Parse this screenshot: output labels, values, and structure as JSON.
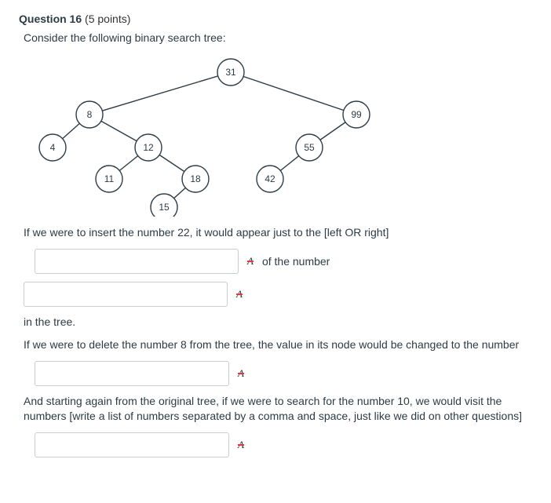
{
  "question": {
    "label": "Question 16",
    "points": "(5 points)",
    "intro": "Consider the following binary search tree:"
  },
  "tree": {
    "root": "31",
    "n8": "8",
    "n99": "99",
    "n4": "4",
    "n12": "12",
    "n55": "55",
    "n11": "11",
    "n18": "18",
    "n42": "42",
    "n15": "15"
  },
  "prompts": {
    "p1": "If we were to insert the number 22, it would appear just to the [left OR right]",
    "p1_after": "of the number",
    "p2": "in the tree.",
    "p3": "If we were to delete the number 8 from the tree, the value in its node would be changed to the number",
    "p4": "And starting again from the original tree, if we were to search for the number 10, we would visit the numbers [write a list of numbers separated by a comma and space, just like we did on other questions]"
  },
  "inputs": {
    "blank1": {
      "value": "",
      "placeholder": ""
    },
    "blank2": {
      "value": "",
      "placeholder": ""
    },
    "blank3": {
      "value": "",
      "placeholder": ""
    },
    "blank4": {
      "value": "",
      "placeholder": ""
    }
  },
  "icons": {
    "spellcheck": "A"
  }
}
